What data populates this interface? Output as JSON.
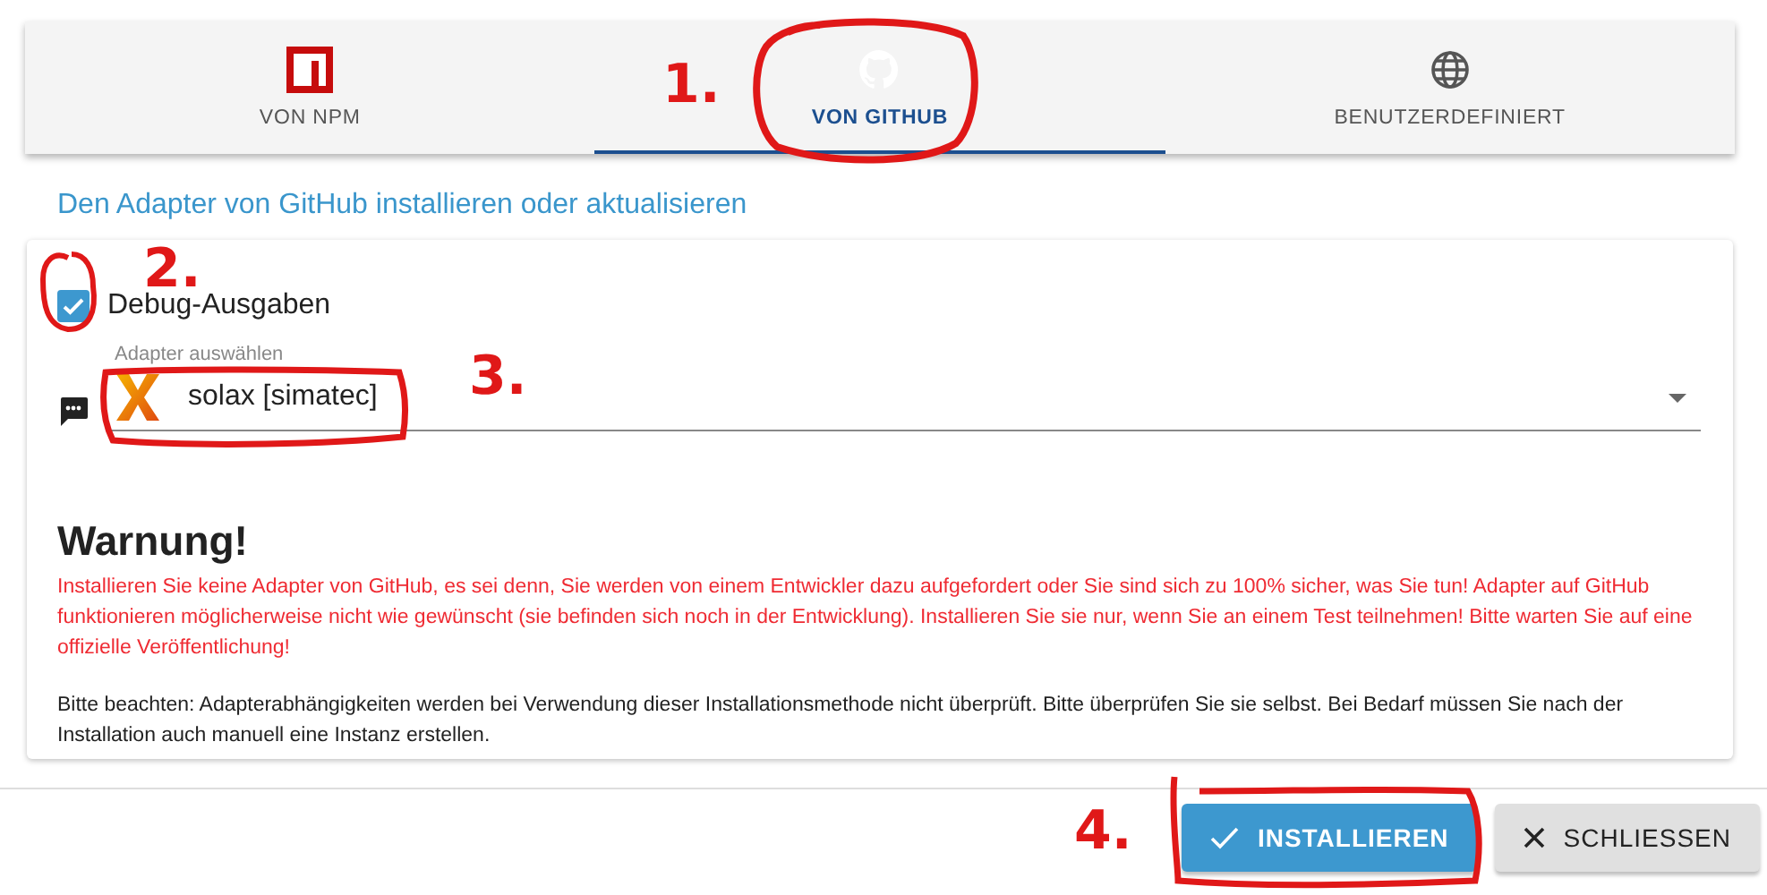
{
  "tabs": [
    {
      "label": "VON NPM",
      "selected": false
    },
    {
      "label": "VON GITHUB",
      "selected": true
    },
    {
      "label": "BENUTZERDEFINIERT",
      "selected": false
    }
  ],
  "heading": "Den Adapter von GitHub installieren oder aktualisieren",
  "debug": {
    "label": "Debug-Ausgaben",
    "checked": true
  },
  "adapter_select": {
    "label": "Adapter auswählen",
    "value": "solax [simatec]"
  },
  "warning": {
    "title": "Warnung!",
    "text": "Installieren Sie keine Adapter von GitHub, es sei denn, Sie werden von einem Entwickler dazu aufgefordert oder Sie sind sich zu 100% sicher, was Sie tun! Adapter auf GitHub funktionieren möglicherweise nicht wie gewünscht (sie befinden sich noch in der Entwicklung). Installieren Sie sie nur, wenn Sie an einem Test teilnehmen! Bitte warten Sie auf eine offizielle Veröffentlichung!",
    "note": "Bitte beachten: Adapterabhängigkeiten werden bei Verwendung dieser Installationsmethode nicht überprüft. Bitte überprüfen Sie sie selbst. Bei Bedarf müssen Sie nach der Installation auch manuell eine Instanz erstellen."
  },
  "buttons": [
    {
      "label": "INSTALLIEREN",
      "kind": "primary"
    },
    {
      "label": "SCHLIESSEN",
      "kind": "secondary"
    }
  ],
  "annotations": [
    {
      "label": "1."
    },
    {
      "label": "2."
    },
    {
      "label": "3."
    },
    {
      "label": "4."
    }
  ]
}
